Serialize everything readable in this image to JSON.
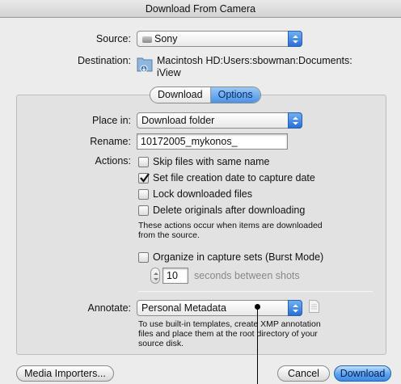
{
  "window": {
    "title": "Download From Camera"
  },
  "source": {
    "label": "Source:",
    "value": "Sony"
  },
  "destination": {
    "label": "Destination:",
    "path": "Macintosh HD:Users:sbowman:Documents:",
    "path_line2": "iView"
  },
  "tabs": [
    {
      "label": "Download",
      "selected": false
    },
    {
      "label": "Options",
      "selected": true
    }
  ],
  "place_in": {
    "label": "Place in:",
    "value": "Download folder"
  },
  "rename": {
    "label": "Rename:",
    "value": "10172005_mykonos_"
  },
  "actions": {
    "label": "Actions:",
    "items": [
      {
        "label": "Skip files with same name",
        "checked": false
      },
      {
        "label": "Set file creation date to capture date",
        "checked": true
      },
      {
        "label": "Lock downloaded files",
        "checked": false
      },
      {
        "label": "Delete originals after downloading",
        "checked": false
      }
    ],
    "note_line1": "These actions occur when items are downloaded",
    "note_line2": "from the source."
  },
  "organize": {
    "label": "Organize in capture sets (Burst Mode)",
    "checked": false,
    "seconds_value": "10",
    "seconds_label": "seconds between shots"
  },
  "annotate": {
    "label": "Annotate:",
    "value": "Personal Metadata",
    "note_line1": "To use built-in templates, create XMP annotation",
    "note_line2": "files and place them at the root directory of your",
    "note_line3": "source disk."
  },
  "buttons": {
    "media_importers": "Media Importers...",
    "cancel": "Cancel",
    "download": "Download"
  },
  "colors": {
    "accent": "#3c8ae6",
    "window_bg": "#ececec"
  }
}
